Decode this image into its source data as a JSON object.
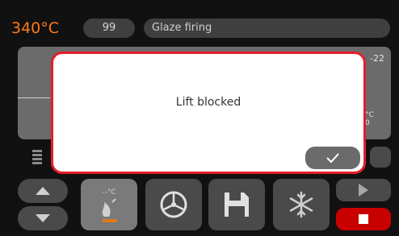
{
  "header": {
    "temperature": "340°C",
    "program_number": "99",
    "program_name": "Glaze firing"
  },
  "panel": {
    "right_top_value": "-22",
    "right_bottom_value": "°C\n0"
  },
  "dialog": {
    "message": "Lift blocked",
    "confirm_icon": "check-icon"
  },
  "toolbar": {
    "tool_a_label": "--°C",
    "icons": [
      "arrow-up-icon",
      "arrow-down-icon",
      "thermometer-flame-icon",
      "wheel-icon",
      "save-icon",
      "snowflake-icon",
      "play-icon",
      "stop-icon"
    ]
  },
  "colors": {
    "temperature": "#ff7a1a",
    "dialog_border": "#e51e2a",
    "stop_button": "#c80000"
  }
}
